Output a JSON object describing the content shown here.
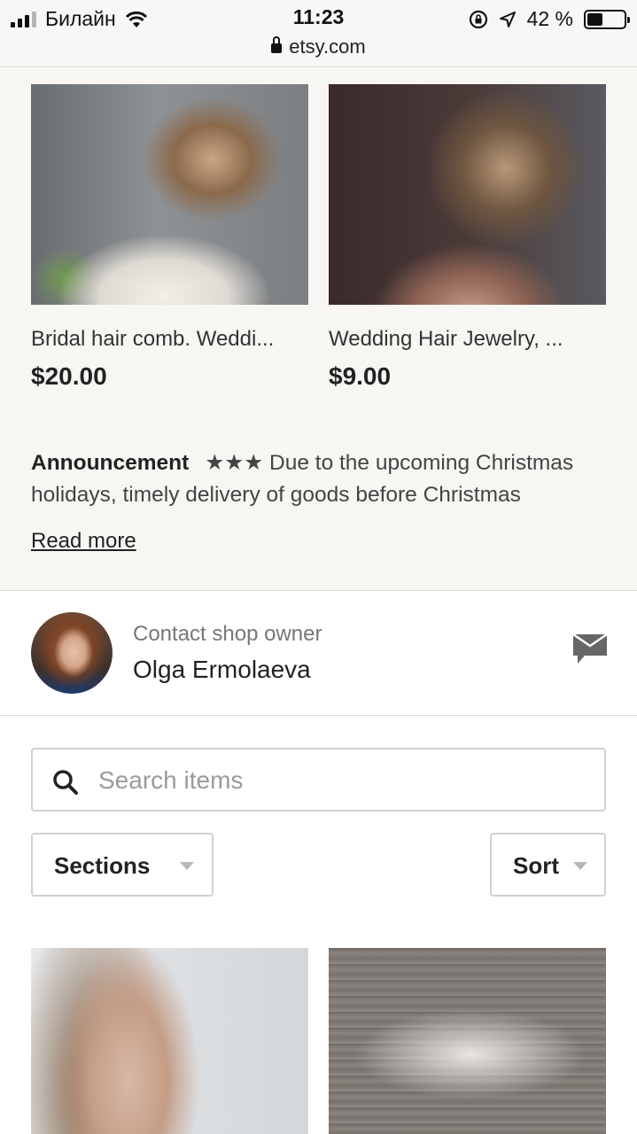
{
  "status_bar": {
    "carrier": "Билайн",
    "time": "11:23",
    "url": "etsy.com",
    "battery": "42 %",
    "battery_level": 0.42
  },
  "featured": {
    "items": [
      {
        "title": "Bridal hair comb. Weddi...",
        "price": "$20.00"
      },
      {
        "title": "Wedding Hair Jewelry, ...",
        "price": "$9.00"
      }
    ]
  },
  "announcement": {
    "label": "Announcement",
    "text": "★★★ Due to the upcoming Christmas holidays, timely delivery of goods before Christmas",
    "read_more": "Read more"
  },
  "contact": {
    "label": "Contact shop owner",
    "name": "Olga Ermolaeva"
  },
  "search": {
    "placeholder": "Search items",
    "value": ""
  },
  "filters": {
    "sections_label": "Sections",
    "sort_label": "Sort"
  },
  "icons": {
    "message": "message-icon",
    "search": "search-icon",
    "lock": "lock-icon",
    "wifi": "wifi-icon",
    "location": "location-arrow-icon",
    "rotation_lock": "rotation-lock-icon"
  }
}
